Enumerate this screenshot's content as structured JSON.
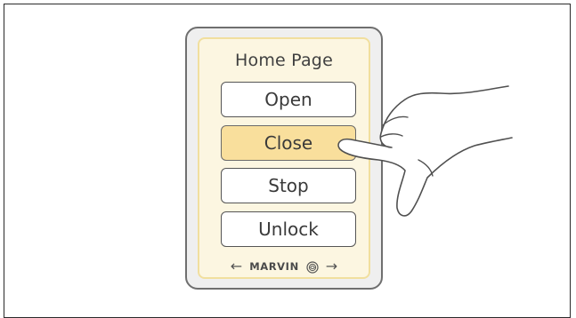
{
  "panel": {
    "title": "Home Page",
    "buttons": [
      {
        "label": "Open",
        "pressed": false
      },
      {
        "label": "Close",
        "pressed": true
      },
      {
        "label": "Stop",
        "pressed": false
      },
      {
        "label": "Unlock",
        "pressed": false
      }
    ],
    "brand": "MARVIN",
    "left_arrow": "←",
    "right_arrow": "→"
  },
  "colors": {
    "screen_background": "#fcf6e1",
    "screen_border": "#f1df9e",
    "pressed_button": "#f9df9c",
    "device_body": "#efefef",
    "device_border": "#6f6f6f"
  },
  "icons": [
    "marvin-logo-icon",
    "left-arrow-icon",
    "right-arrow-icon",
    "hand-pointer-icon"
  ]
}
